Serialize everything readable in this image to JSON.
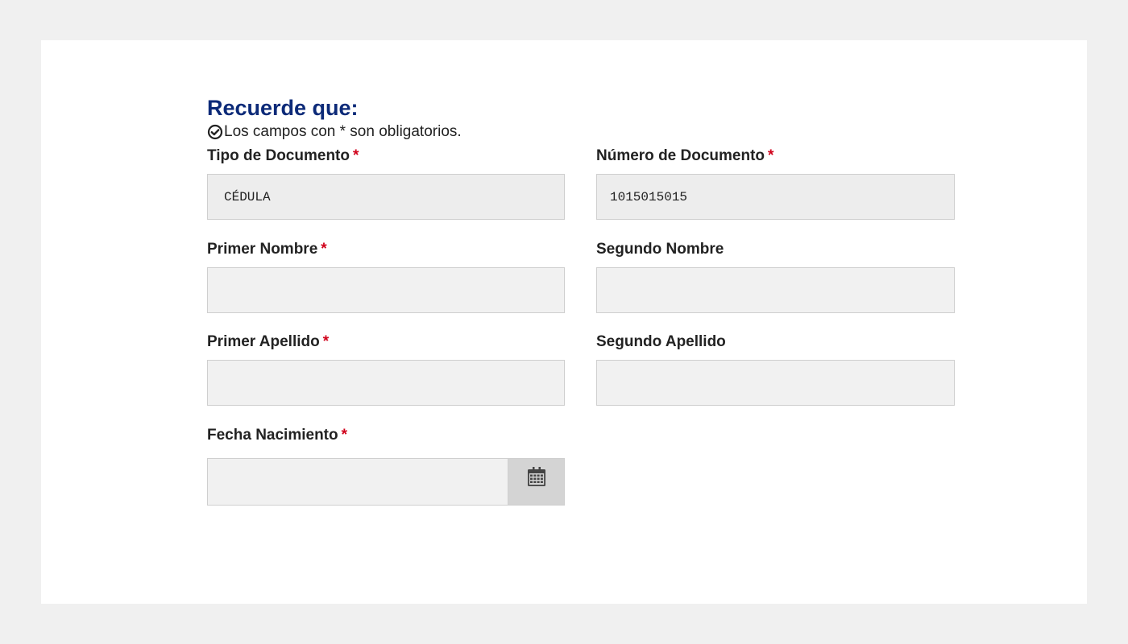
{
  "notice": {
    "title": "Recuerde que:",
    "text": "Los campos con * son obligatorios.",
    "icon": "check-circle-icon"
  },
  "fields": {
    "tipo_documento": {
      "label": "Tipo de Documento",
      "required": "*",
      "value": "CÉDULA"
    },
    "numero_documento": {
      "label": "Número de Documento",
      "required": "*",
      "value": "1015015015"
    },
    "primer_nombre": {
      "label": "Primer Nombre",
      "required": "*",
      "value": ""
    },
    "segundo_nombre": {
      "label": "Segundo Nombre",
      "value": ""
    },
    "primer_apellido": {
      "label": "Primer Apellido",
      "required": "*",
      "value": ""
    },
    "segundo_apellido": {
      "label": "Segundo Apellido",
      "value": ""
    },
    "fecha_nacimiento": {
      "label": "Fecha Nacimiento",
      "required": "*",
      "value": "",
      "icon": "calendar-icon"
    }
  },
  "colors": {
    "title": "#0c2a78",
    "required": "#d0021b",
    "page_bg": "#f0f0f0",
    "input_bg": "#f1f1f1"
  }
}
